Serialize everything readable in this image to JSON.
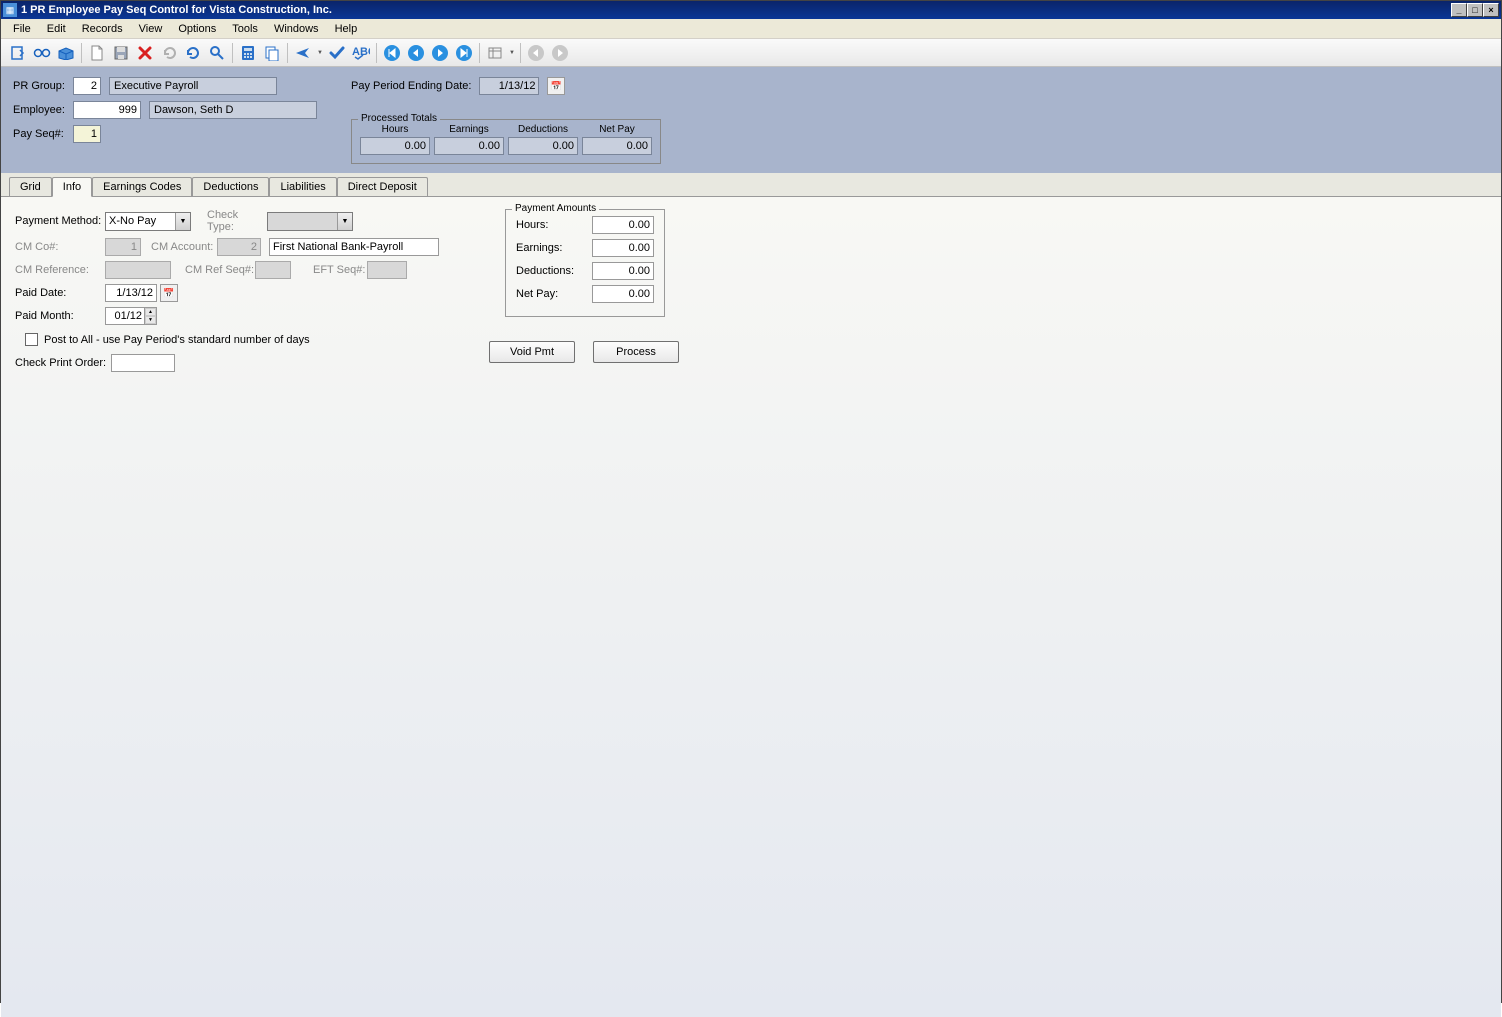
{
  "titlebar": {
    "text": "1 PR Employee Pay Seq Control for Vista Construction, Inc."
  },
  "menu": {
    "file": "File",
    "edit": "Edit",
    "records": "Records",
    "view": "View",
    "options": "Options",
    "tools": "Tools",
    "windows": "Windows",
    "help": "Help"
  },
  "header": {
    "pr_group_label": "PR Group:",
    "pr_group_value": "2",
    "pr_group_desc": "Executive Payroll",
    "employee_label": "Employee:",
    "employee_value": "999",
    "employee_name": "Dawson, Seth D",
    "pay_seq_label": "Pay Seq#:",
    "pay_seq_value": "1",
    "pay_period_label": "Pay Period Ending Date:",
    "pay_period_value": "1/13/12"
  },
  "processed_totals": {
    "legend": "Processed Totals",
    "hours_label": "Hours",
    "hours_value": "0.00",
    "earnings_label": "Earnings",
    "earnings_value": "0.00",
    "deductions_label": "Deductions",
    "deductions_value": "0.00",
    "netpay_label": "Net Pay",
    "netpay_value": "0.00"
  },
  "tabs": {
    "grid": "Grid",
    "info": "Info",
    "earnings": "Earnings Codes",
    "deductions": "Deductions",
    "liabilities": "Liabilities",
    "direct_deposit": "Direct Deposit"
  },
  "info_form": {
    "payment_method_label": "Payment Method:",
    "payment_method_value": "X-No Pay",
    "check_type_label": "Check Type:",
    "cm_co_label": "CM Co#:",
    "cm_co_value": "1",
    "cm_account_label": "CM Account:",
    "cm_account_value": "2",
    "cm_account_desc": "First National Bank-Payroll",
    "cm_reference_label": "CM Reference:",
    "cm_ref_seq_label": "CM Ref Seq#:",
    "eft_seq_label": "EFT Seq#:",
    "paid_date_label": "Paid Date:",
    "paid_date_value": "1/13/12",
    "paid_month_label": "Paid Month:",
    "paid_month_value": "01/12",
    "post_to_all_label": "Post to All - use Pay Period's standard number of days",
    "check_print_order_label": "Check Print Order:"
  },
  "payment_amounts": {
    "legend": "Payment Amounts",
    "hours_label": "Hours:",
    "hours_value": "0.00",
    "earnings_label": "Earnings:",
    "earnings_value": "0.00",
    "deductions_label": "Deductions:",
    "deductions_value": "0.00",
    "netpay_label": "Net Pay:",
    "netpay_value": "0.00"
  },
  "buttons": {
    "void": "Void Pmt",
    "process": "Process"
  }
}
